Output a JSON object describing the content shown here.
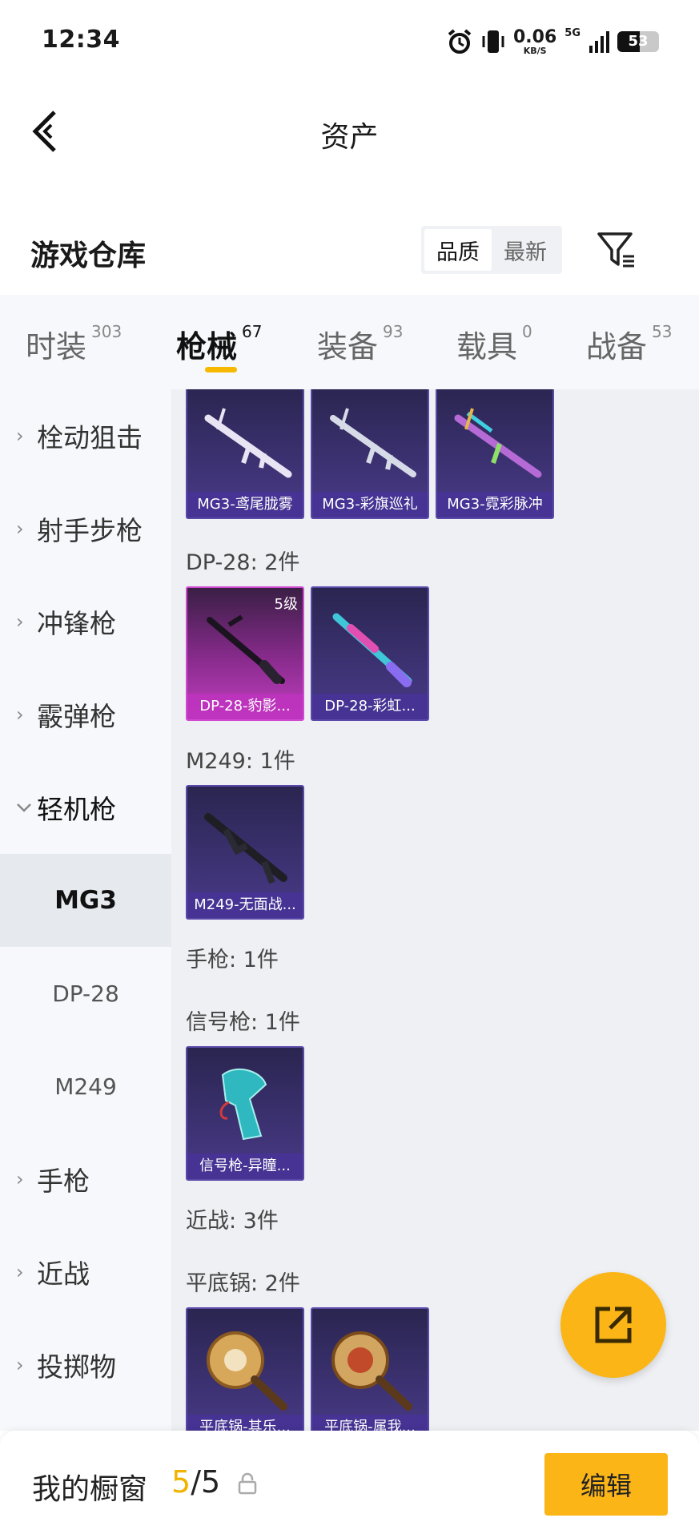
{
  "status_bar": {
    "time": "12:34",
    "net_speed_value": "0.06",
    "net_speed_unit": "KB/S",
    "network": "5G",
    "battery": "53",
    "battery_level": 0.53
  },
  "header": {
    "title": "资产"
  },
  "warehouse": {
    "title": "游戏仓库",
    "sort_options": [
      "品质",
      "最新"
    ],
    "sort_selected": "品质"
  },
  "category_tabs": [
    {
      "label": "时装",
      "count": "303",
      "active": false
    },
    {
      "label": "枪械",
      "count": "67",
      "active": true
    },
    {
      "label": "装备",
      "count": "93",
      "active": false
    },
    {
      "label": "载具",
      "count": "0",
      "active": false
    },
    {
      "label": "战备",
      "count": "53",
      "active": false
    }
  ],
  "sidebar": {
    "items": [
      {
        "label": "栓动狙击",
        "expanded": false
      },
      {
        "label": "射手步枪",
        "expanded": false
      },
      {
        "label": "冲锋枪",
        "expanded": false
      },
      {
        "label": "霰弹枪",
        "expanded": false
      },
      {
        "label": "轻机枪",
        "expanded": true
      }
    ],
    "subitems": [
      {
        "label": "MG3",
        "active": true
      },
      {
        "label": "DP-28",
        "active": false
      },
      {
        "label": "M249",
        "active": false
      }
    ],
    "items_after": [
      {
        "label": "手枪",
        "expanded": false
      },
      {
        "label": "近战",
        "expanded": false
      },
      {
        "label": "投掷物",
        "expanded": false
      }
    ]
  },
  "content": {
    "mg3_cards": [
      {
        "name": "MG3-鸢尾胧雾",
        "color": "#d9d4e8"
      },
      {
        "name": "MG3-彩旗巡礼",
        "color": "#cfd3e0"
      },
      {
        "name": "MG3-霓彩脉冲",
        "color": "#b56ad6"
      }
    ],
    "dp28_title": "DP-28: 2件",
    "dp28_cards": [
      {
        "name": "DP-28-豹影...",
        "level": "5级"
      },
      {
        "name": "DP-28-彩虹...",
        "color": "#3fc6d8"
      }
    ],
    "m249_title": "M249: 1件",
    "m249_cards": [
      {
        "name": "M249-无面战..."
      }
    ],
    "pistol_title": "手枪: 1件",
    "flare_title": "信号枪: 1件",
    "flare_cards": [
      {
        "name": "信号枪-异瞳..."
      }
    ],
    "melee_title": "近战: 3件",
    "pan_title": "平底锅: 2件",
    "pan_cards": [
      {
        "name": "平底锅-其乐..."
      },
      {
        "name": "平底锅-属我..."
      }
    ]
  },
  "bottom_bar": {
    "label": "我的橱窗",
    "current": "5",
    "separator": "/",
    "total": "5",
    "edit_label": "编辑"
  },
  "colors": {
    "accent": "#fbb516",
    "tab_underline": "#f6b800",
    "card_purple": "#3b3170",
    "card_pink": "#c13fc0"
  },
  "icons": {
    "back": "back-arrow-icon",
    "filter": "filter-icon",
    "fab": "share-external-icon",
    "lock": "lock-icon",
    "chevron_right": "chevron-right-icon",
    "chevron_down": "chevron-down-icon"
  }
}
